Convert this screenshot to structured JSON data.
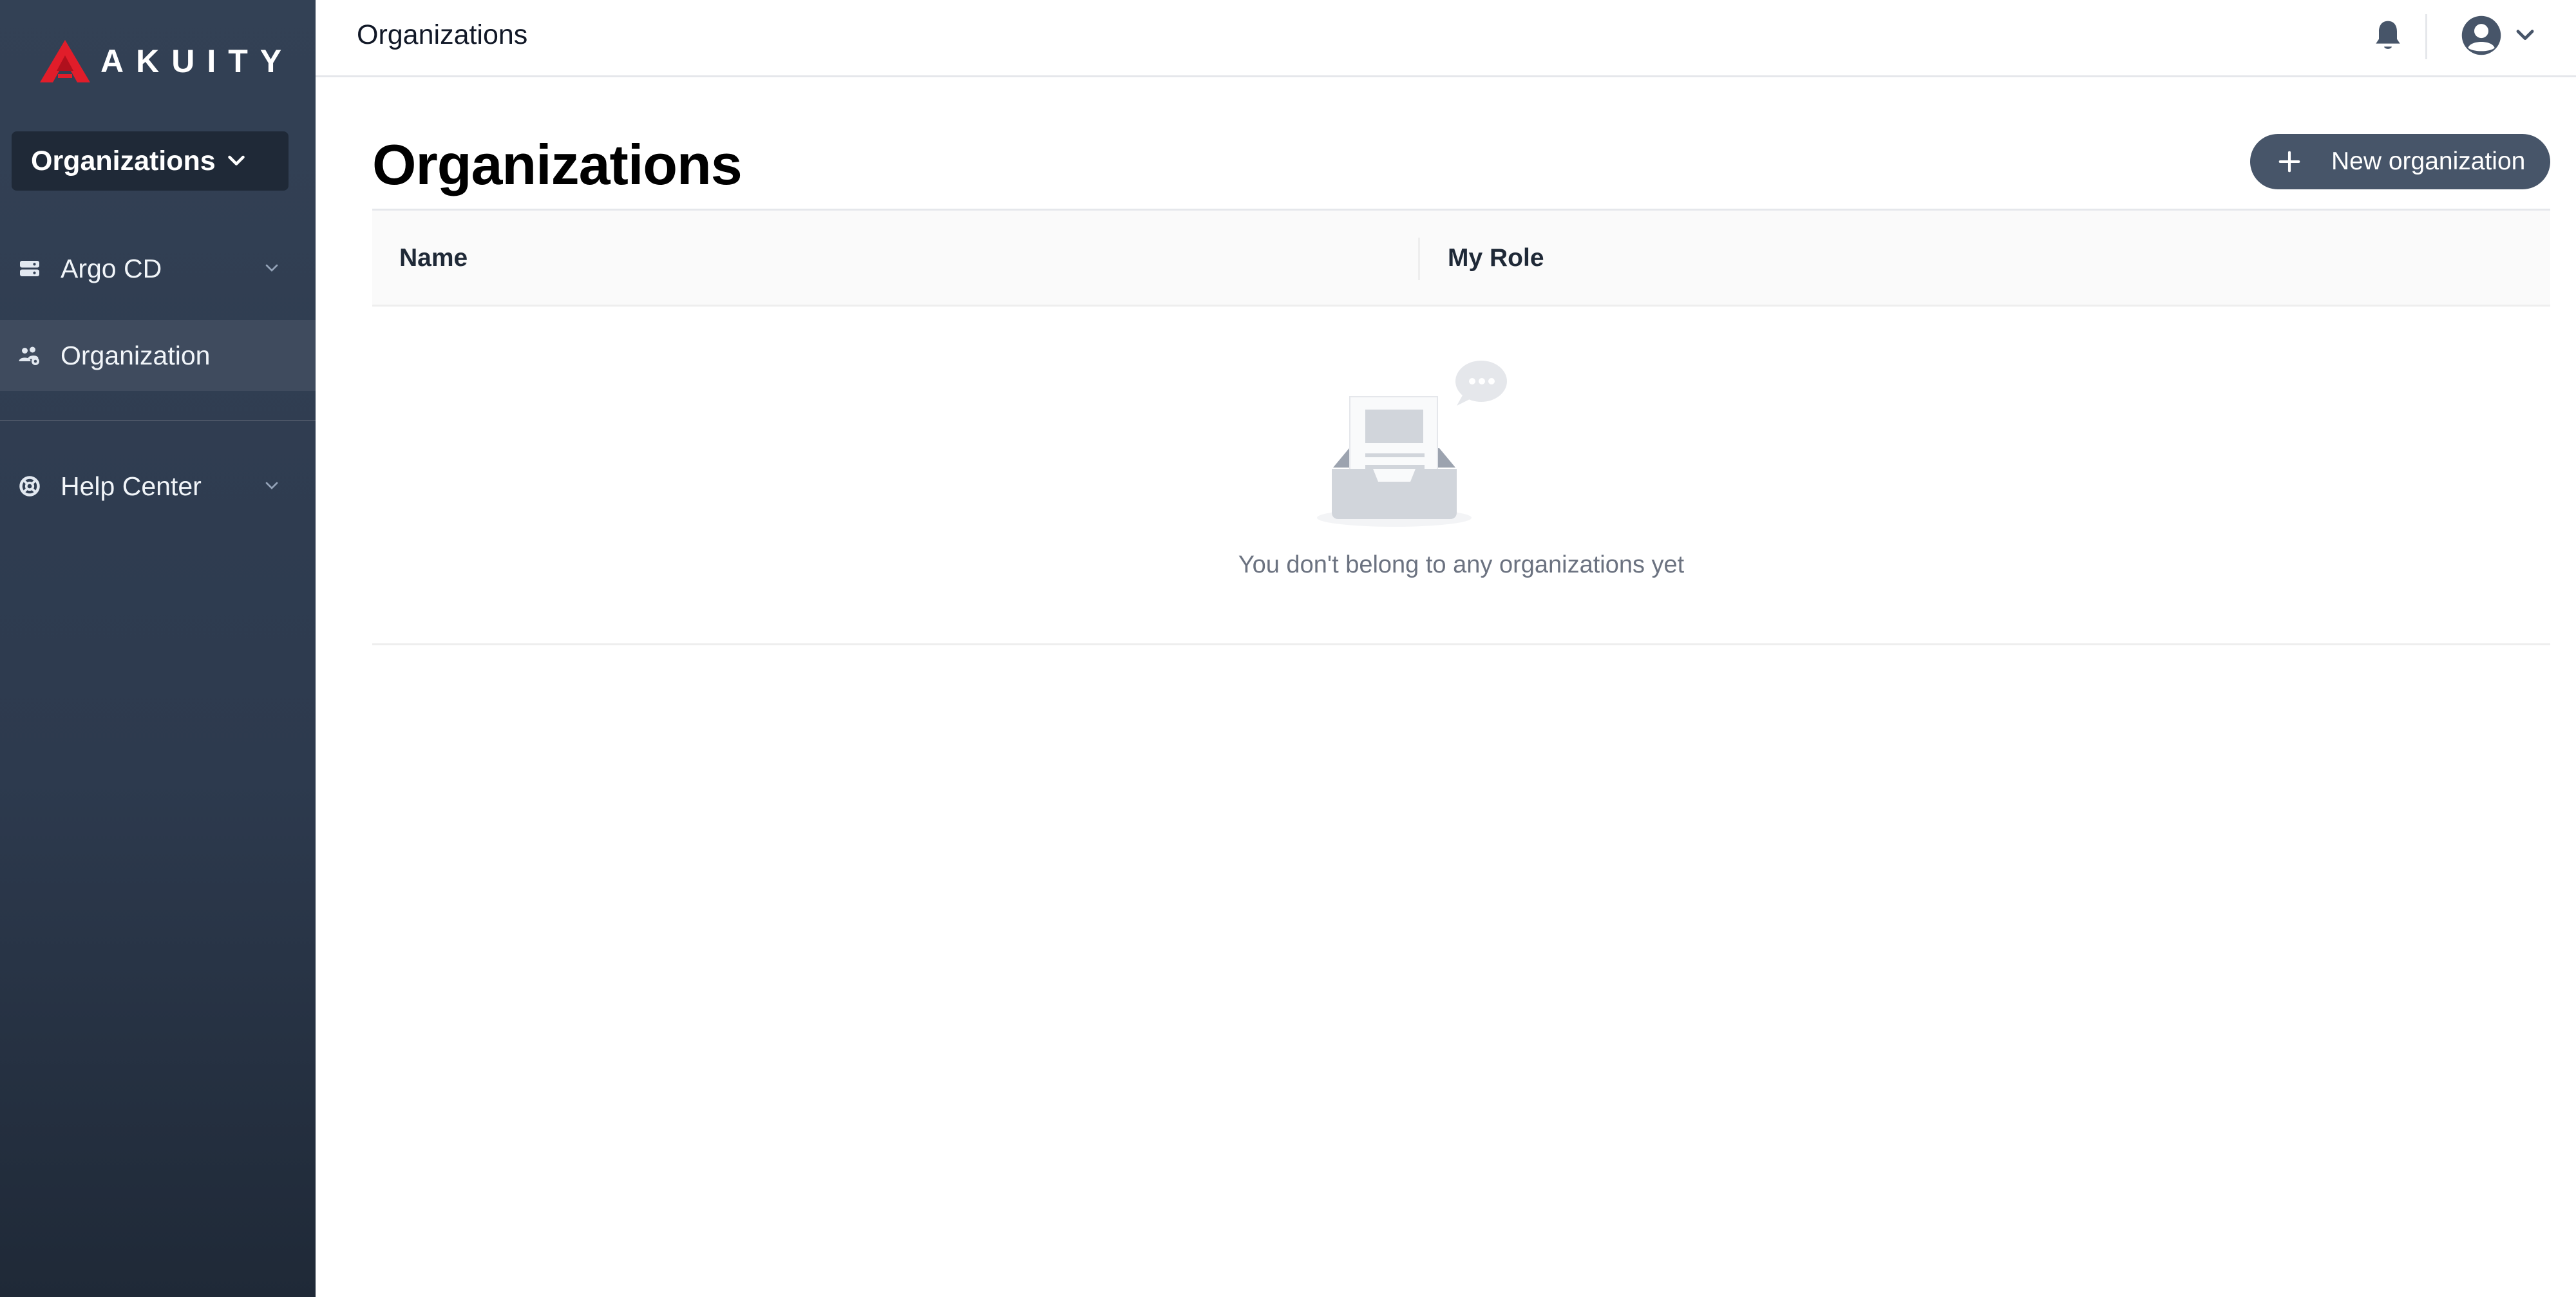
{
  "brand": {
    "name": "AKUITY",
    "logo_color": "#e11d2a"
  },
  "sidebar": {
    "switcher_label": "Organizations",
    "items": [
      {
        "label": "Argo CD",
        "icon": "server-icon",
        "has_chevron": true
      },
      {
        "label": "Organization",
        "icon": "users-icon",
        "active": true
      },
      {
        "label": "Help Center",
        "icon": "lifebuoy-icon",
        "has_chevron": true
      }
    ]
  },
  "topbar": {
    "title": "Organizations"
  },
  "main": {
    "title": "Organizations",
    "new_button_label": "New organization",
    "table": {
      "columns": [
        "Name",
        "My Role"
      ],
      "rows": [],
      "empty_text": "You don't belong to any organizations yet"
    }
  },
  "colors": {
    "sidebar_top": "#334155",
    "sidebar_bottom": "#1f2937",
    "button": "#475569",
    "accent_red": "#e11d2a"
  }
}
